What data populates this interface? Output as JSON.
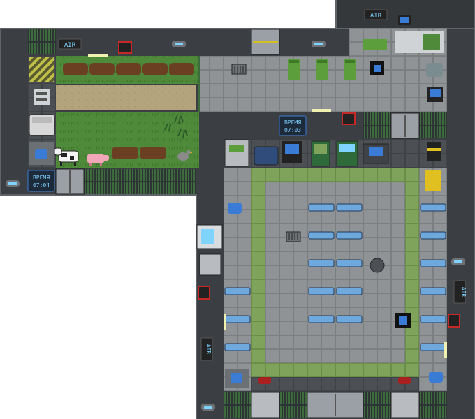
{
  "clocks": {
    "farm": {
      "word": "ВРЕМЯ",
      "time": "07:04"
    },
    "hall": {
      "word": "ВРЕМЯ",
      "time": "07:03"
    }
  },
  "air_labels": {
    "top": "AIR",
    "farm": "AIR",
    "hall_right": "AIR",
    "hall_left": "AIR"
  },
  "colors": {
    "void": "#ffffff",
    "wall": "#3b3f43",
    "wall_edge": "#5e6368",
    "floor_steel": "#8f9396",
    "floor_dark": "#4c5054",
    "grass": "#4f8a3a",
    "soil": "#6a3f22",
    "sand": "#b3a47e",
    "green_tile": "#7fa35a",
    "table": "#6fa8dc",
    "locker": "#5c9e3c",
    "alarm": "#c62828",
    "screen_text": "#7fd3ff"
  },
  "icons": [
    "air-vent-icon",
    "air-alarm-icon",
    "fire-alarm-icon",
    "clock-icon",
    "door-icon",
    "locker-icon",
    "vending-machine-icon",
    "table-icon",
    "chair-icon",
    "cow-icon",
    "pig-icon",
    "chicken-icon",
    "sink-icon",
    "light-icon",
    "grille-icon",
    "computer-icon"
  ]
}
